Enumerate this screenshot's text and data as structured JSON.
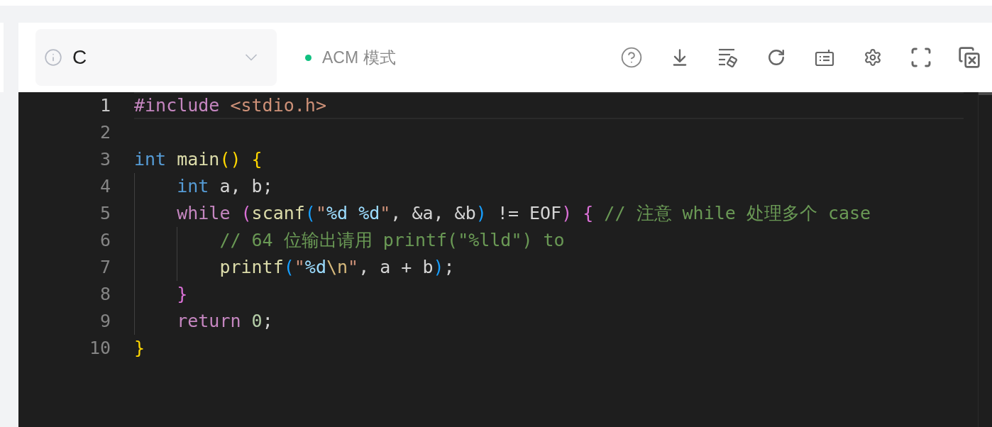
{
  "toolbar": {
    "language_select": {
      "value": "C"
    },
    "mode": {
      "label": "ACM 模式"
    }
  },
  "editor": {
    "lines": [
      {
        "number": "1",
        "current": true,
        "tokens": [
          {
            "text": "#include ",
            "color": "#c586c0"
          },
          {
            "text": "<stdio.h>",
            "color": "#ce9178"
          }
        ]
      },
      {
        "number": "2",
        "current": false
      },
      {
        "number": "3",
        "current": false,
        "tokens": [
          {
            "text": "int ",
            "color": "#569cd6"
          },
          {
            "text": "main",
            "color": "#dcdcaa"
          },
          {
            "text": "()",
            "color": "#ffd700"
          },
          {
            "text": " {",
            "color": "#ffd700"
          }
        ]
      },
      {
        "number": "4",
        "current": false,
        "tokens": [
          {
            "text": "    int ",
            "color": "#569cd6"
          },
          {
            "text": "a, b;",
            "color": "#d4d4d4"
          }
        ]
      },
      {
        "number": "5",
        "current": false,
        "tokens": [
          {
            "text": "    while ",
            "color": "#c586c0"
          },
          {
            "text": "(",
            "color": "#da70d6"
          },
          {
            "text": "scanf",
            "color": "#dcdcaa"
          },
          {
            "text": "(",
            "color": "#179fff"
          },
          {
            "text": "\"",
            "color": "#ce9178"
          },
          {
            "text": "%d",
            "color": "#9cdcfe"
          },
          {
            "text": " %d",
            "color": "#9cdcfe"
          },
          {
            "text": "\"",
            "color": "#ce9178"
          },
          {
            "text": ", &a, &b",
            "color": "#d4d4d4"
          },
          {
            "text": ")",
            "color": "#179fff"
          },
          {
            "text": " != EOF",
            "color": "#d4d4d4"
          },
          {
            "text": ") {",
            "color": "#da70d6"
          },
          {
            "text": " // 注意 while 处理多个 case",
            "color": "#6a9955"
          }
        ]
      },
      {
        "number": "6",
        "current": false,
        "tokens": [
          {
            "text": "        // 64 位输出请用 printf(\"%lld\") to",
            "color": "#6a9955"
          }
        ]
      },
      {
        "number": "7",
        "current": false,
        "tokens": [
          {
            "text": "        printf",
            "color": "#dcdcaa"
          },
          {
            "text": "(",
            "color": "#179fff"
          },
          {
            "text": "\"",
            "color": "#ce9178"
          },
          {
            "text": "%d",
            "color": "#9cdcfe"
          },
          {
            "text": "\\n",
            "color": "#d7ba7d"
          },
          {
            "text": "\"",
            "color": "#ce9178"
          },
          {
            "text": ", a + b",
            "color": "#d4d4d4"
          },
          {
            "text": ")",
            "color": "#179fff"
          },
          {
            "text": ";",
            "color": "#d4d4d4"
          }
        ]
      },
      {
        "number": "8",
        "current": false,
        "tokens": [
          {
            "text": "    }",
            "color": "#da70d6"
          }
        ]
      },
      {
        "number": "9",
        "current": false,
        "tokens": [
          {
            "text": "    return ",
            "color": "#c586c0"
          },
          {
            "text": "0",
            "color": "#b5cea8"
          },
          {
            "text": ";",
            "color": "#d4d4d4"
          }
        ]
      },
      {
        "number": "10",
        "current": false,
        "tokens": [
          {
            "text": "}",
            "color": "#ffd700"
          }
        ]
      }
    ]
  }
}
